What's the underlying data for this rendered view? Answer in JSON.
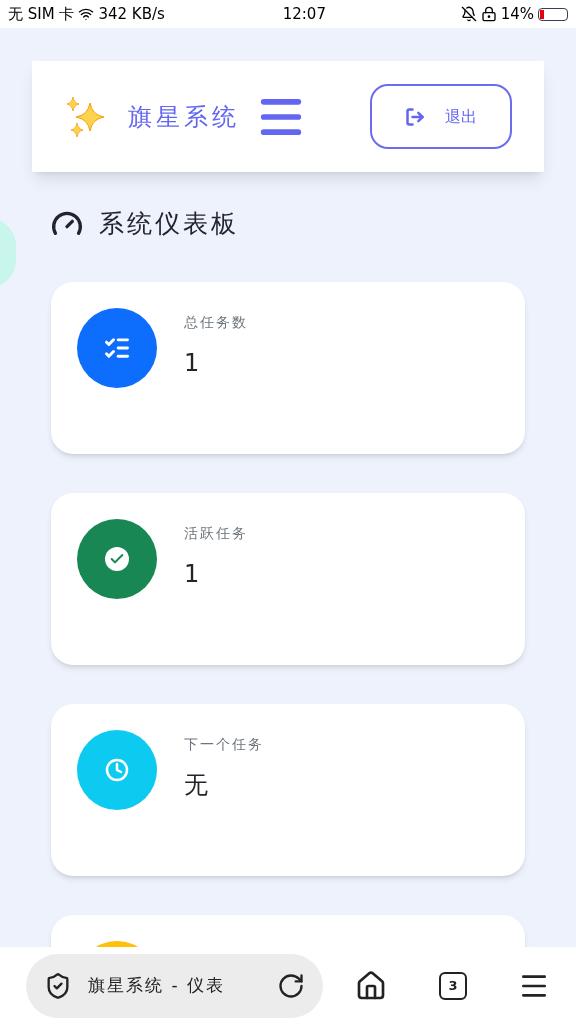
{
  "status_bar": {
    "carrier": "无 SIM 卡",
    "speed": "342 KB/s",
    "time": "12:07",
    "battery": "14%"
  },
  "header": {
    "title": "旗星系统",
    "logout": "退出"
  },
  "section": {
    "title": "系统仪表板"
  },
  "cards": [
    {
      "kind": "tasks",
      "color": "#0d6efd",
      "label": "总任务数",
      "value": "1"
    },
    {
      "kind": "check",
      "color": "#198754",
      "label": "活跃任务",
      "value": "1"
    },
    {
      "kind": "clock",
      "color": "#0dcaf0",
      "label": "下一个任务",
      "value": "无"
    },
    {
      "kind": "plain",
      "color": "#ffc107"
    }
  ],
  "browser_bar": {
    "page_title": "旗星系统 - 仪表",
    "tab_count": "3"
  }
}
